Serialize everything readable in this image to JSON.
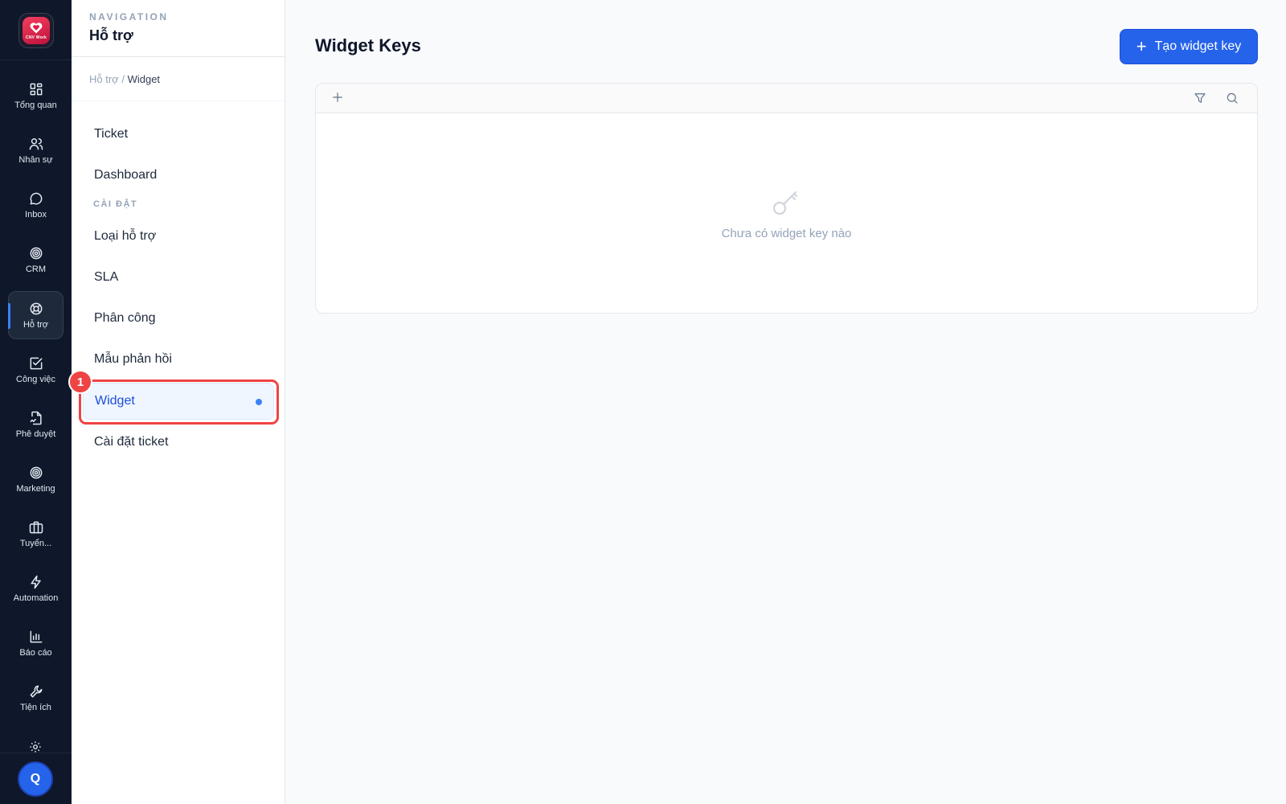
{
  "rail": {
    "logo_text": "CNV Work",
    "items": [
      {
        "label": "Tổng quan",
        "icon": "dashboard-grid-icon"
      },
      {
        "label": "Nhân sự",
        "icon": "users-icon"
      },
      {
        "label": "Inbox",
        "icon": "chat-bubble-icon"
      },
      {
        "label": "CRM",
        "icon": "target-icon"
      },
      {
        "label": "Hỗ trợ",
        "icon": "lifebuoy-icon",
        "active": true
      },
      {
        "label": "Công việc",
        "icon": "checkbox-icon"
      },
      {
        "label": "Phê duyệt",
        "icon": "document-sign-icon"
      },
      {
        "label": "Marketing",
        "icon": "target-icon"
      },
      {
        "label": "Tuyển...",
        "icon": "briefcase-icon"
      },
      {
        "label": "Automation",
        "icon": "lightning-icon"
      },
      {
        "label": "Báo cáo",
        "icon": "bar-chart-icon"
      },
      {
        "label": "Tiện ích",
        "icon": "wrench-icon"
      }
    ],
    "avatar_initial": "Q"
  },
  "nav": {
    "eyebrow": "NAVIGATION",
    "title": "Hỗ trợ",
    "breadcrumb": {
      "parent": "Hỗ trợ",
      "separator": "/",
      "current": "Widget"
    },
    "items": [
      {
        "label": "Ticket"
      },
      {
        "label": "Dashboard"
      },
      {
        "label": "Loại hỗ trợ"
      },
      {
        "label": "SLA"
      },
      {
        "label": "Phân công"
      },
      {
        "label": "Mẫu phản hồi"
      },
      {
        "label": "Widget",
        "active": true
      },
      {
        "label": "Cài đặt ticket"
      }
    ],
    "section_label": "CÀI ĐẶT",
    "annotation_badge": "1"
  },
  "main": {
    "title": "Widget Keys",
    "create_button_label": "Tạo widget key",
    "empty_state_text": "Chưa có widget key nào"
  },
  "colors": {
    "rail_bg": "#0f172a",
    "accent": "#2563eb",
    "highlight": "#ef4444"
  }
}
